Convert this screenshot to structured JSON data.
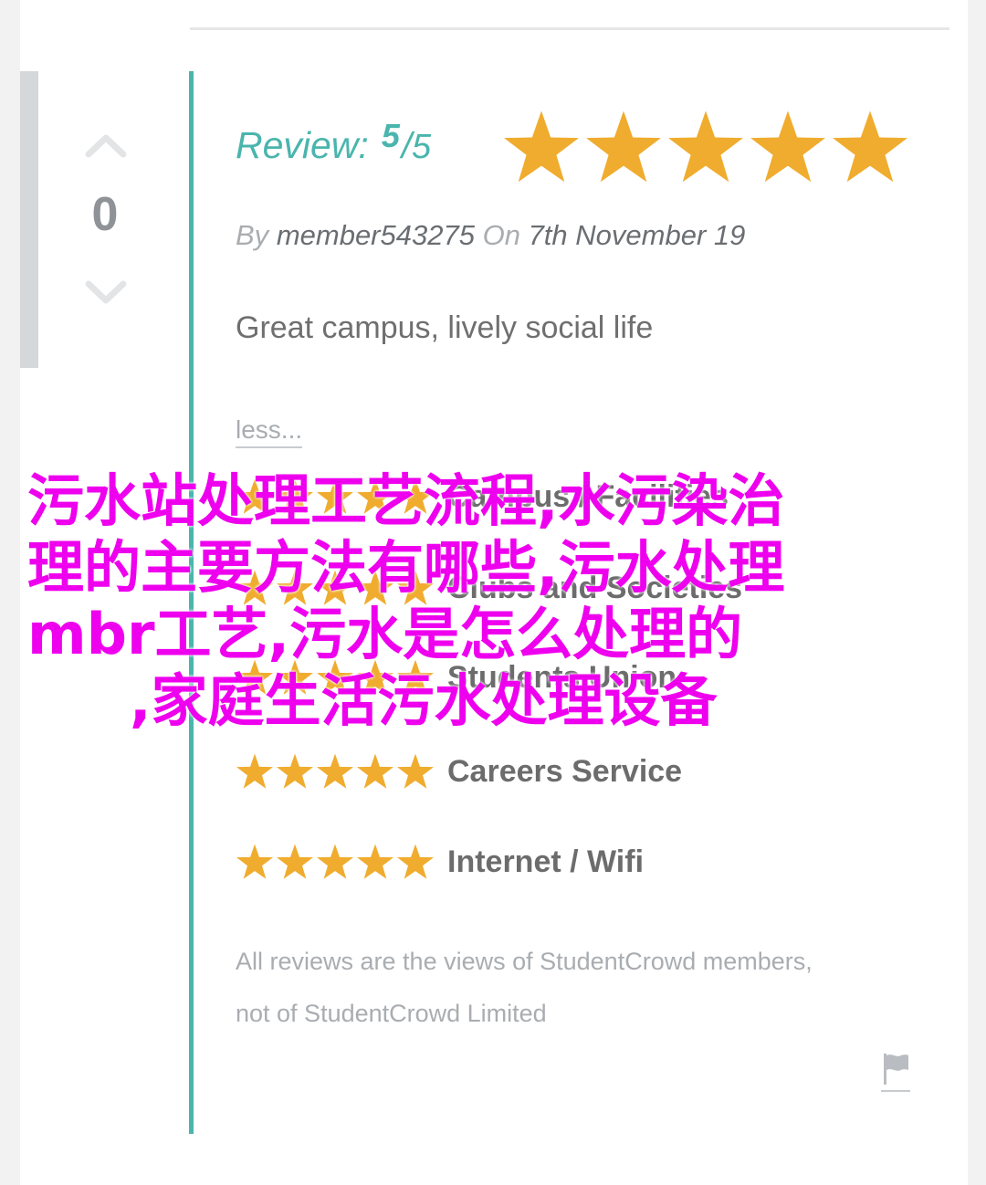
{
  "vote": {
    "count": "0",
    "up_icon": "chevron-up-icon",
    "down_icon": "chevron-down-icon"
  },
  "review": {
    "label": "Review:",
    "score": "5",
    "slash": "/",
    "max": "5",
    "stars_filled": 5,
    "by_label": "By",
    "author": "member543275",
    "on_label": "On",
    "date": "7th November 19",
    "title": "Great campus, lively social life",
    "less_link": "less..."
  },
  "categories": [
    {
      "label": "Campus / Facilities",
      "stars": 5
    },
    {
      "label": "Clubs and Societies",
      "stars": 5
    },
    {
      "label": "Students Union",
      "stars": 5
    },
    {
      "label": "Careers Service",
      "stars": 5
    },
    {
      "label": "Internet / Wifi",
      "stars": 5
    }
  ],
  "disclaimer": {
    "line1": "All reviews are the views of StudentCrowd members,",
    "line2": "not of StudentCrowd Limited"
  },
  "flag": {
    "icon": "flag-icon"
  },
  "overlay": {
    "lines": [
      "污水站处理工艺流程,水污染治",
      "理的主要方法有哪些,污水处理",
      "mbr工艺,污水是怎么处理的",
      ",家庭生活污水处理设备"
    ]
  },
  "colors": {
    "accent_teal": "#4ab5ad",
    "star_gold": "#f0ac2e",
    "overlay_magenta": "#ee00ee",
    "muted_grey": "#a9adb1"
  }
}
